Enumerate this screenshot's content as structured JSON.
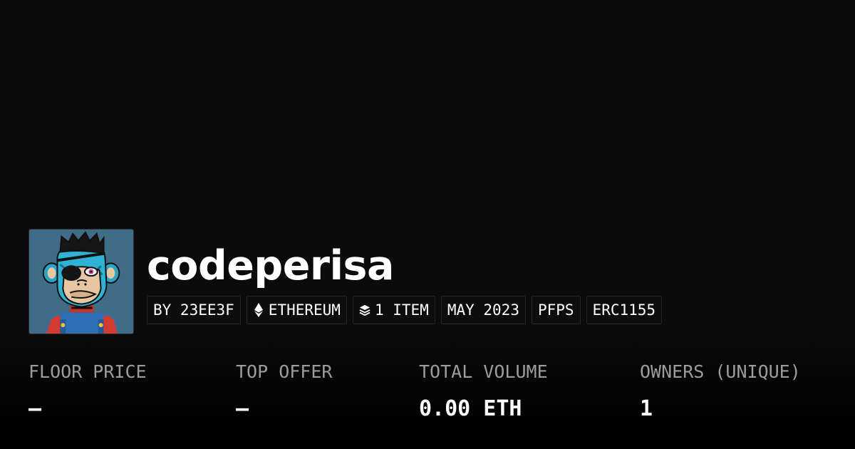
{
  "collection": {
    "name": "codeperisa",
    "avatar_alt": "ape-avatar"
  },
  "tags": [
    {
      "label": "BY 23EE3F",
      "icon": ""
    },
    {
      "label": "ETHEREUM",
      "icon": "ethereum-icon"
    },
    {
      "label": "1 ITEM",
      "icon": "layers-icon"
    },
    {
      "label": "MAY 2023",
      "icon": ""
    },
    {
      "label": "PFPS",
      "icon": ""
    },
    {
      "label": "ERC1155",
      "icon": ""
    }
  ],
  "stats": [
    {
      "label": "FLOOR PRICE",
      "value": "—"
    },
    {
      "label": "TOP OFFER",
      "value": "—"
    },
    {
      "label": "TOTAL VOLUME",
      "value": "0.00 ETH"
    },
    {
      "label": "OWNERS (UNIQUE)",
      "value": "1"
    }
  ],
  "colors": {
    "background": "#0b0b0b",
    "label_gray": "#9c9c9c",
    "avatar_bg": "#3f6d87"
  }
}
